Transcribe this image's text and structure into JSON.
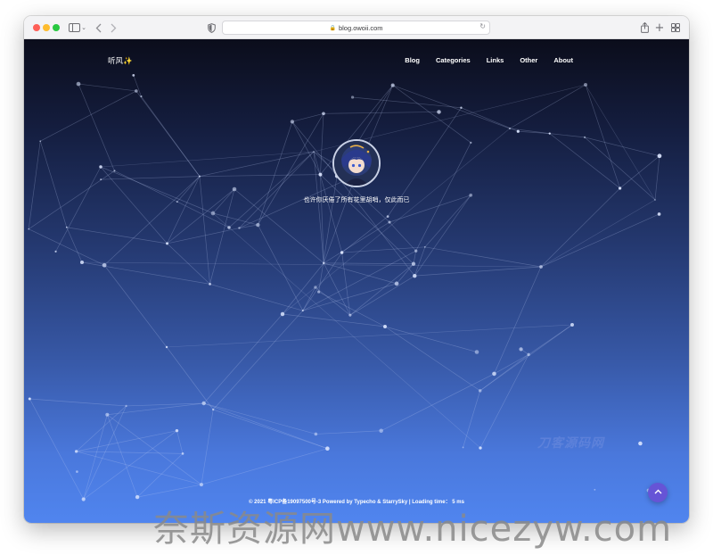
{
  "browser": {
    "url": "blog.owoii.com",
    "icons": {
      "sidebar": "sidebar-icon",
      "back": "chevron-left-icon",
      "forward": "chevron-right-icon",
      "privacy": "shield-icon",
      "lock": "lock-icon",
      "reload": "reload-icon",
      "share": "share-icon",
      "new_tab": "plus-icon",
      "tabs": "tab-overview-icon"
    }
  },
  "site": {
    "brand": "听风✨",
    "nav": [
      "Blog",
      "Categories",
      "Links",
      "Other",
      "About"
    ],
    "tagline": "也许你厌倦了所有花里胡哨，仅此而已",
    "watermark": "刀客源码网",
    "footer": {
      "copyright": "© 2021",
      "icp": "粤ICP备19097500号-3",
      "powered_prefix": "Powered by",
      "typecho": "Typecho",
      "amp": "&",
      "starrysky": "StarrySky",
      "loading": "| Loading time： 5 ms"
    },
    "back_to_top_icon": "arrow-up-icon"
  },
  "overlay_text": "奈斯资源网www.nicezyw.com",
  "colors": {
    "gradient_top": "#0b0d1b",
    "gradient_bottom": "#5085ef",
    "back_to_top": "#6654d6",
    "traffic_red": "#fe5f57",
    "traffic_yellow": "#febc2e",
    "traffic_green": "#28c840"
  }
}
